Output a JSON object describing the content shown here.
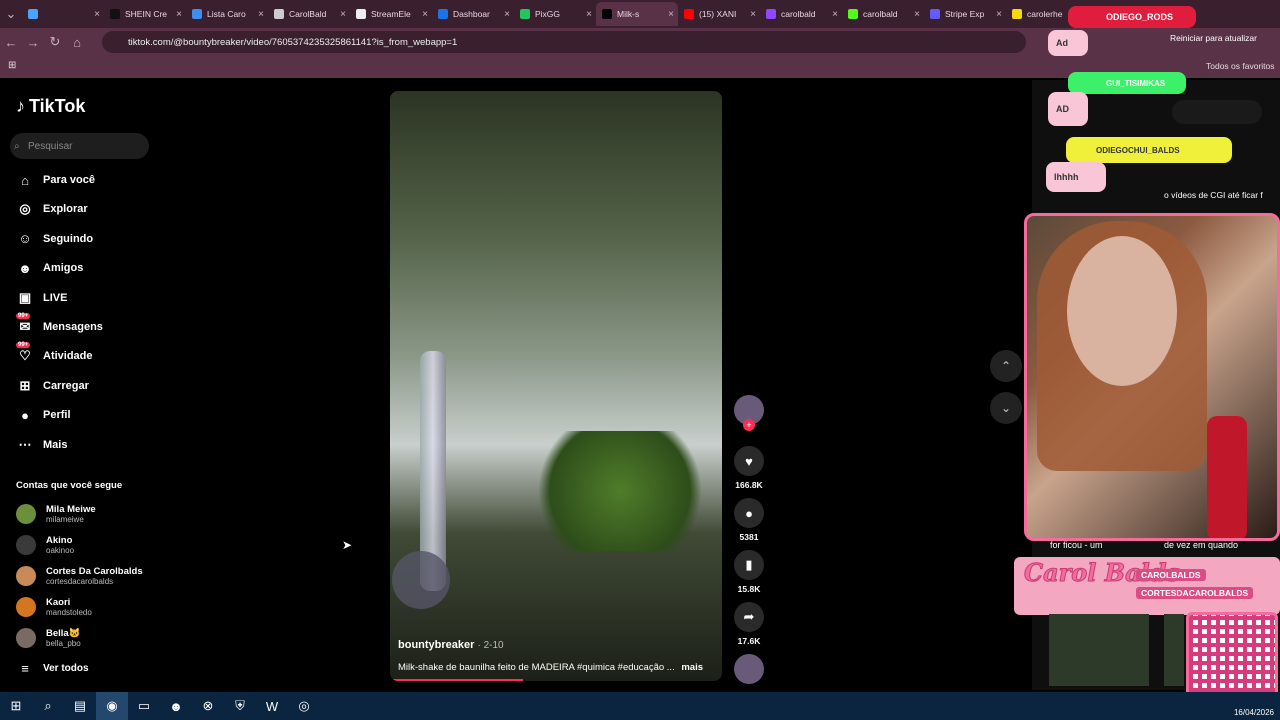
{
  "browser": {
    "tabs": [
      {
        "label": "",
        "color": "#4aa3ff"
      },
      {
        "label": "SHEIN Cre",
        "color": "#111111"
      },
      {
        "label": "Lista Caro",
        "color": "#3c8ef0"
      },
      {
        "label": "CarolBald",
        "color": "#cccccc"
      },
      {
        "label": "StreamEle",
        "color": "#eeeeee"
      },
      {
        "label": "Dashboar",
        "color": "#1a73e8"
      },
      {
        "label": "PixGG",
        "color": "#22c55e"
      },
      {
        "label": "Milk-s",
        "color": "#000000",
        "active": true
      },
      {
        "label": "(15) XANI",
        "color": "#ff0000"
      },
      {
        "label": "carolbald",
        "color": "#9146ff"
      },
      {
        "label": "carolbald",
        "color": "#53fc18"
      },
      {
        "label": "Stripe Exp",
        "color": "#635bff"
      },
      {
        "label": "carolerhe",
        "color": "#f5d90a"
      }
    ],
    "url": "tiktok.com/@bountybreaker/video/7605374235325861141?is_from_webapp=1",
    "reset_label": "Reiniciar para atualizar",
    "favorites_label": "Todos os favoritos"
  },
  "tiktok": {
    "logo": "TikTok",
    "search_placeholder": "Pesquisar",
    "nav": [
      {
        "label": "Para você",
        "icon": "home-icon"
      },
      {
        "label": "Explorar",
        "icon": "compass-icon"
      },
      {
        "label": "Seguindo",
        "icon": "following-icon"
      },
      {
        "label": "Amigos",
        "icon": "friends-icon"
      },
      {
        "label": "LIVE",
        "icon": "live-icon"
      },
      {
        "label": "Mensagens",
        "icon": "messages-icon",
        "badge": "99+"
      },
      {
        "label": "Atividade",
        "icon": "activity-icon",
        "badge": "99+"
      },
      {
        "label": "Carregar",
        "icon": "upload-icon"
      },
      {
        "label": "Perfil",
        "icon": "profile-icon"
      },
      {
        "label": "Mais",
        "icon": "more-icon"
      }
    ],
    "following_heading": "Contas que você segue",
    "accounts": [
      {
        "name": "Mila Meiwe",
        "handle": "milameiwe",
        "color": "#6b8f3a"
      },
      {
        "name": "Akino",
        "handle": "oakinoo",
        "color": "#3a3a3a"
      },
      {
        "name": "Cortes Da Carolbalds",
        "handle": "cortesdacarolbalds",
        "color": "#c98a5a"
      },
      {
        "name": "Kaori",
        "handle": "mandstoledo",
        "color": "#d4761f"
      },
      {
        "name": "Bella🐱",
        "handle": "bella_pbo",
        "color": "#7a6a66"
      }
    ],
    "see_all": "Ver todos",
    "video": {
      "author": "bountybreaker",
      "date": "· 2-10",
      "description": "Milk-shake de baunilha feito de MADEIRA #quimica #educação ...",
      "more": "mais",
      "progress": 0.4
    },
    "actions": {
      "likes": "166.8K",
      "comments": "5381",
      "saves": "15.8K",
      "shares": "17.6K"
    }
  },
  "overlay": {
    "chat_chips": [
      "ODIEGO_RODS",
      "GUI_TISIMIKAS",
      "ODIEGOCHUI_BALDS"
    ],
    "ad_labels": [
      "Ad",
      "AD"
    ],
    "message": "lhhhh",
    "caption_right": "o vídeos de CGI até ficar f",
    "carol_name": "Carol Balds",
    "social_handles": [
      "CAROLBALDS",
      "CORTESDACAROLBALDS"
    ],
    "subtitle_left": "for ficou - um",
    "subtitle_right": "de vez em quando"
  },
  "taskbar": {
    "date": "16/04/2026"
  }
}
